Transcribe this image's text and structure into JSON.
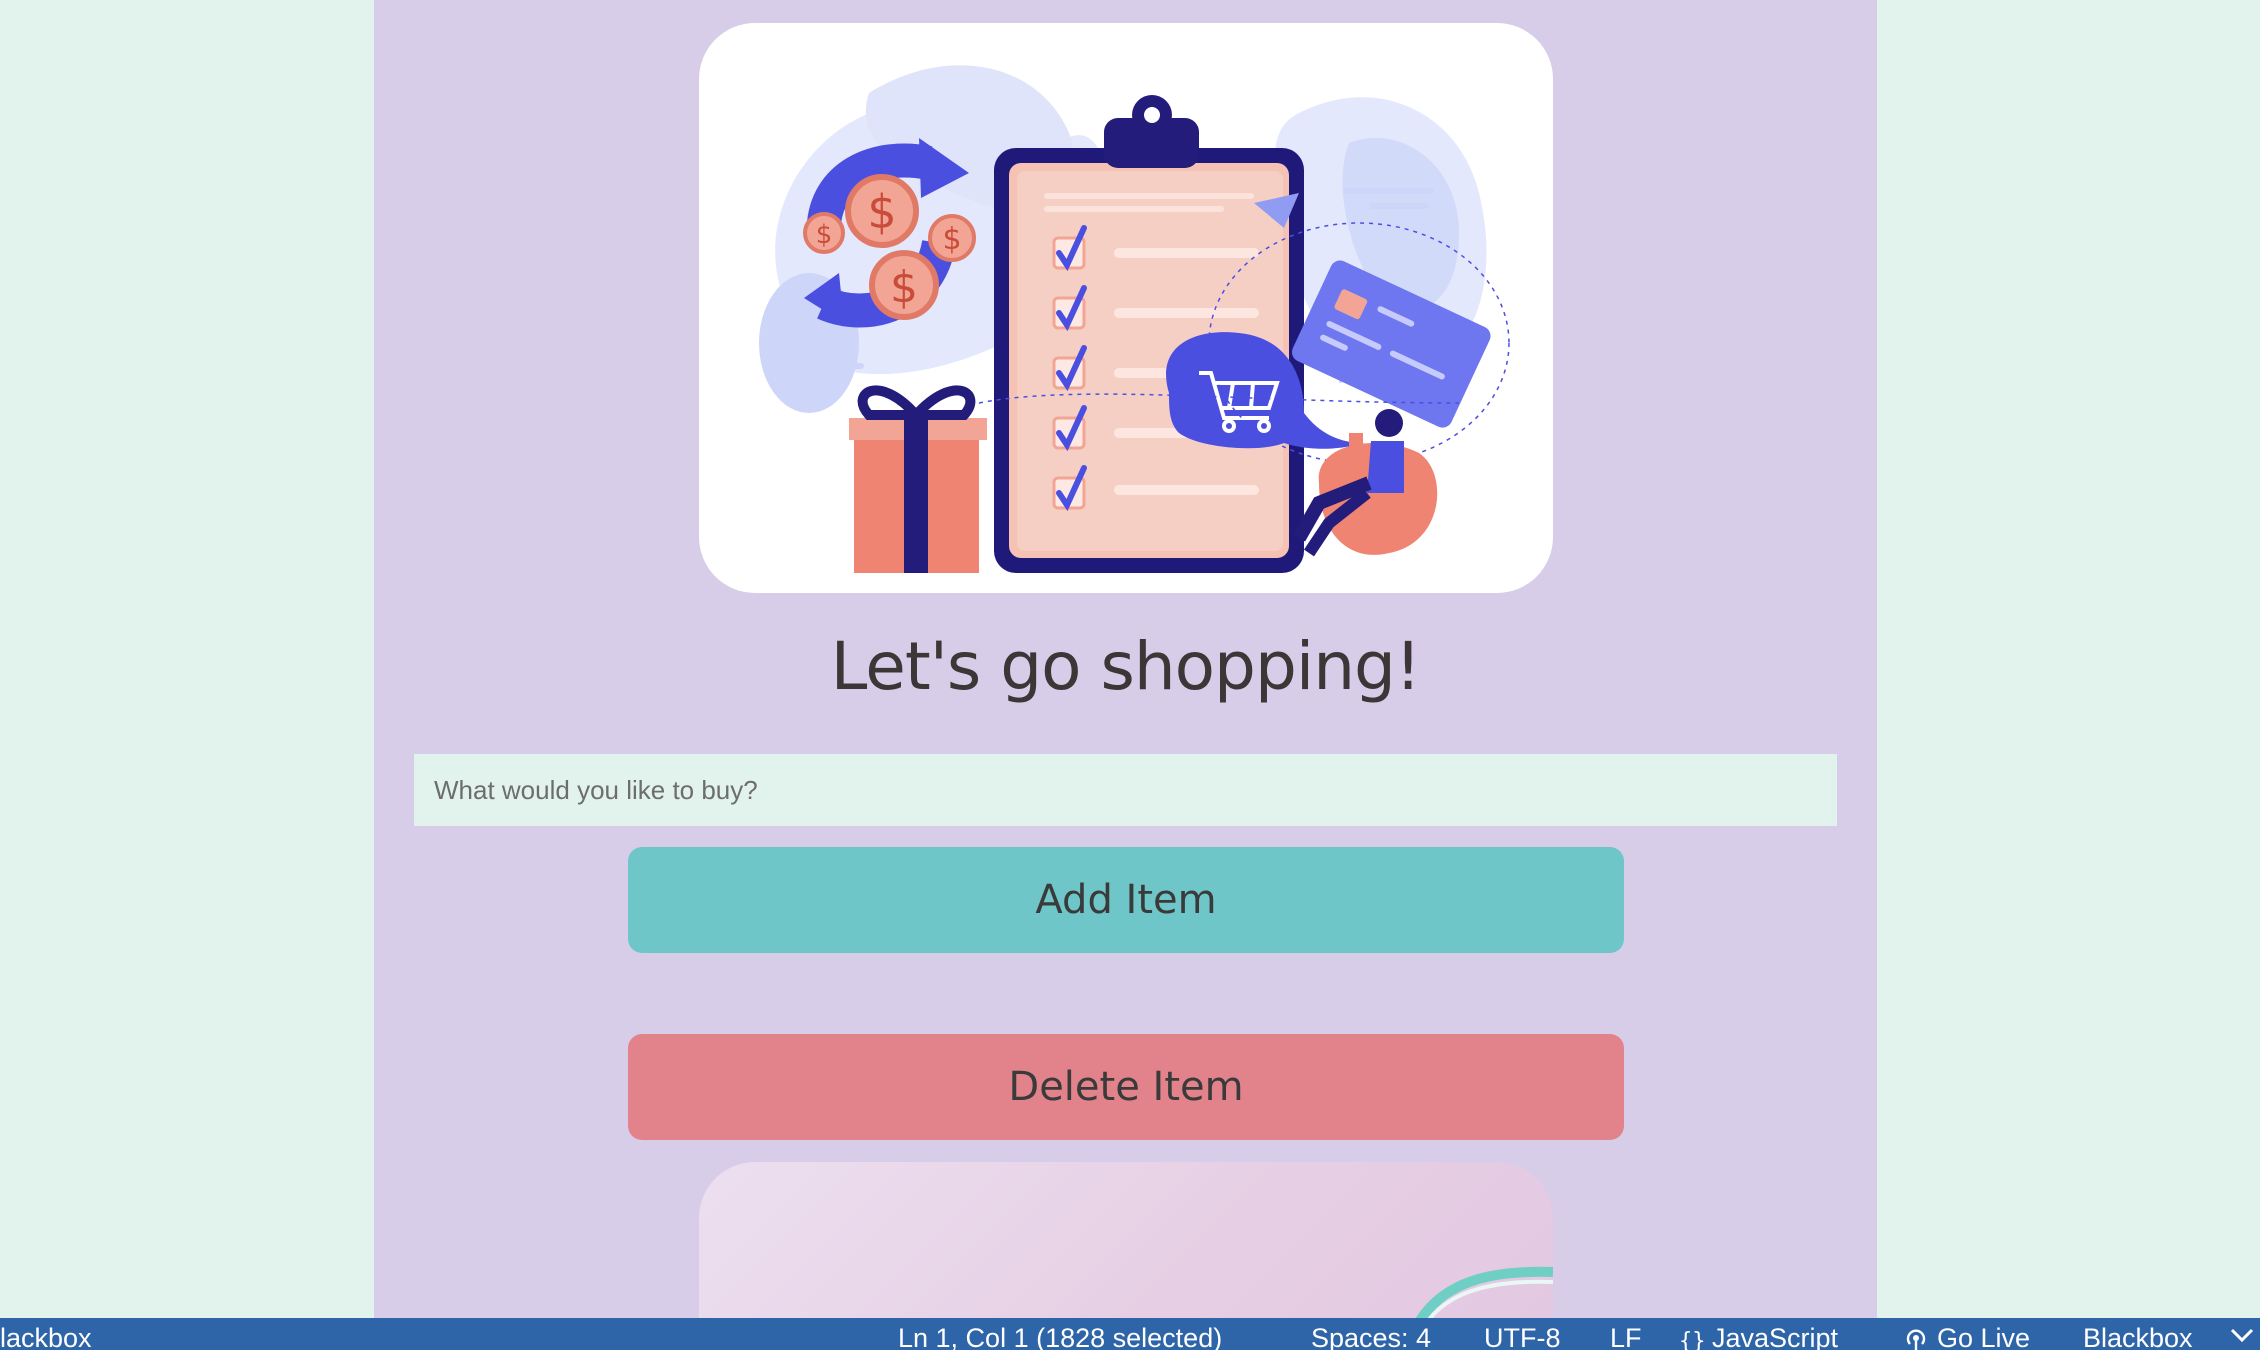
{
  "hero": {
    "illustration": "shopping-checklist-illustration"
  },
  "title": "Let's go shopping!",
  "input": {
    "placeholder": "What would you like to buy?",
    "value": ""
  },
  "buttons": {
    "add_label": "Add Item",
    "delete_label": "Delete Item"
  },
  "colors": {
    "page_bg": "#d8cde9",
    "outer_bg": "#e2f3ee",
    "add_button": "#6ec6c8",
    "delete_button": "#e2838c",
    "statusbar": "#2e64a8"
  },
  "statusbar": {
    "left": "lackbox",
    "position": "Ln 1, Col 1 (1828 selected)",
    "spaces": "Spaces: 4",
    "encoding": "UTF-8",
    "eol": "LF",
    "language": "JavaScript",
    "go_live": "Go Live",
    "blackbox": "Blackbox",
    "language_icon": "braces-icon",
    "go_live_icon": "broadcast-icon"
  }
}
